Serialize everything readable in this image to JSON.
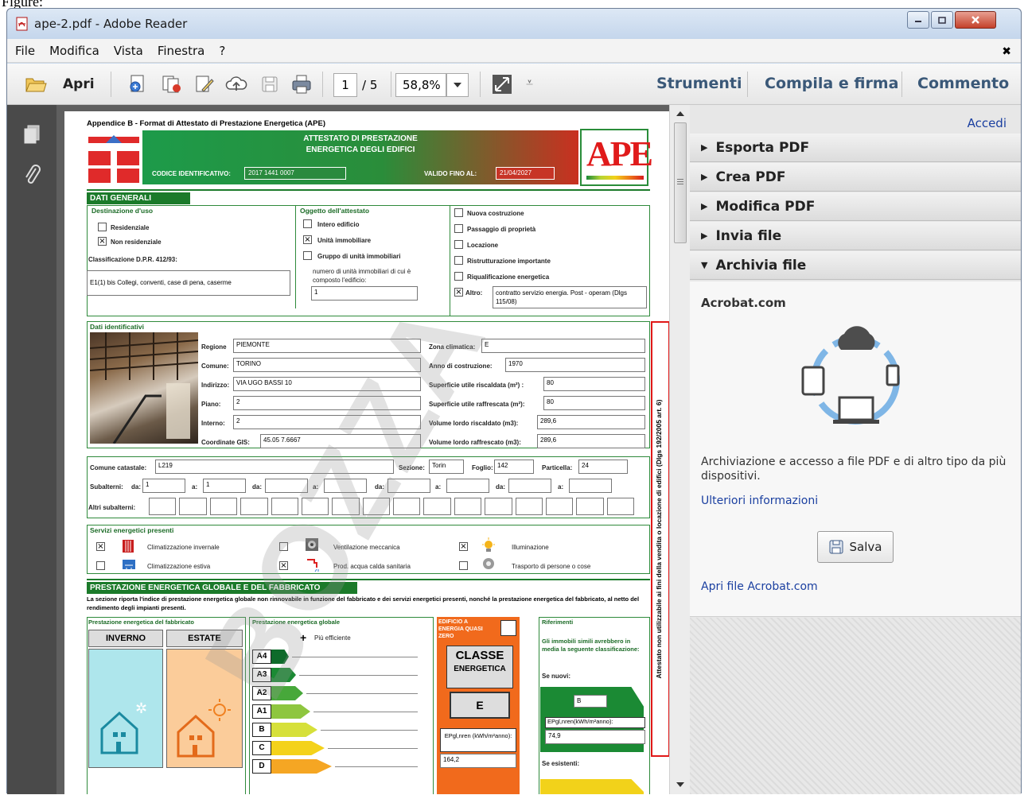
{
  "above_text": "Figure:",
  "window": {
    "title": "ape-2.pdf - Adobe Reader"
  },
  "menu": [
    "File",
    "Modifica",
    "Vista",
    "Finestra",
    "?"
  ],
  "toolbar": {
    "open_label": "Apri",
    "page_current": "1",
    "page_total": "/ 5",
    "zoom": "58,8%",
    "tools_label": "Strumenti",
    "fill_sign_label": "Compila e firma",
    "comment_label": "Commento"
  },
  "right_panel": {
    "signin": "Accedi",
    "sections": [
      {
        "label": "Esporta PDF",
        "expanded": false
      },
      {
        "label": "Crea PDF",
        "expanded": false
      },
      {
        "label": "Modifica PDF",
        "expanded": false
      },
      {
        "label": "Invia file",
        "expanded": false
      },
      {
        "label": "Archivia file",
        "expanded": true
      }
    ],
    "acrobat_title": "Acrobat.com",
    "description": "Archiviazione e accesso a file PDF e di altro tipo da più dispositivi.",
    "more_info": "Ulteriori informazioni",
    "save_label": "Salva",
    "open_acrobat": "Apri file Acrobat.com"
  },
  "doc": {
    "appendix_title": "Appendice B - Format di Attestato di Prestazione Energetica (APE)",
    "header_title_1": "ATTESTATO DI PRESTAZIONE",
    "header_title_2": "ENERGETICA DEGLI EDIFICI",
    "code_label": "CODICE IDENTIFICATIVO:",
    "code_value": "2017 1441 0007",
    "valid_label": "VALIDO FINO AL:",
    "valid_value": "21/04/2027",
    "ape_logo": "APE",
    "dati_generali": "DATI GENERALI",
    "destinazione_title": "Destinazione d'uso",
    "residenziale": "Residenziale",
    "non_residenziale": "Non residenziale",
    "classificazione_label": "Classificazione D.P.R. 412/93:",
    "classificazione_value": "E1(1) bis Collegi, conventi, case di pena, caserme",
    "oggetto_title": "Oggetto dell'attestato",
    "intero_edificio": "Intero edificio",
    "unita_immobiliare": "Unità immobiliare",
    "gruppo_unita": "Gruppo di unità immobiliari",
    "numero_unita_label": "numero di unità immobiliari di cui è composto l'edificio:",
    "numero_unita_value": "1",
    "nuova_costruzione": "Nuova costruzione",
    "passaggio": "Passaggio di proprietà",
    "locazione": "Locazione",
    "ristrutturazione": "Ristrutturazione importante",
    "riqualificazione": "Riqualificazione energetica",
    "altro_label": "Altro:",
    "altro_value": "contratto servizio energia. Post - operam (Dlgs 115/08)",
    "dati_identificativi": "Dati identificativi",
    "regione_label": "Regione",
    "regione_value": "PIEMONTE",
    "comune_label": "Comune:",
    "comune_value": "TORINO",
    "indirizzo_label": "Indirizzo:",
    "indirizzo_value": "VIA UGO BASSI 10",
    "piano_label": "Piano:",
    "piano_value": "2",
    "interno_label": "Interno:",
    "interno_value": "2",
    "gis_label": "Coordinate GIS:",
    "gis_value": "45.05 7.6667",
    "zona_label": "Zona climatica:",
    "zona_value": "E",
    "anno_label": "Anno di costruzione:",
    "anno_value": "1970",
    "sup_risc_label": "Superficie utile riscaldata (m²) :",
    "sup_risc_value": "80",
    "sup_raff_label": "Superficie utile raffrescata (m²):",
    "sup_raff_value": "80",
    "vol_risc_label": "Volume lordo riscaldato (m3):",
    "vol_risc_value": "289,6",
    "vol_raff_label": "Volume lordo raffrescato (m3):",
    "vol_raff_value": "289,6",
    "comune_catastale_label": "Comune catastale:",
    "comune_catastale_value": "L219",
    "sezione_label": "Sezione:",
    "sezione_value": "Torin",
    "foglio_label": "Foglio:",
    "foglio_value": "142",
    "particella_label": "Particella:",
    "particella_value": "24",
    "subalterni_label": "Subalterni:",
    "da_label": "da:",
    "a_label": "a:",
    "sub_da_value": "1",
    "sub_a_value": "1",
    "altri_subalterni_label": "Altri subalterni:",
    "servizi_title": "Servizi energetici presenti",
    "clim_invernale": "Climatizzazione invernale",
    "clim_estiva": "Climatizzazione estiva",
    "ventilazione": "Ventilazione meccanica",
    "acqua_calda": "Prod. acqua calda sanitaria",
    "illuminazione": "Illuminazione",
    "trasporto": "Trasporto di persone o cose",
    "prestazione_title": "PRESTAZIONE ENERGETICA GLOBALE E DEL FABBRICATO",
    "prestazione_desc": "La sezione riporta l'indice di prestazione energetica globale non rinnovabile in funzione del fabbricato e dei servizi energetici presenti, nonché la prestazione energetica del fabbricato, al netto del rendimento degli impianti presenti.",
    "prest_fabbricato": "Prestazione energetica del fabbricato",
    "inverno": "INVERNO",
    "estate": "ESTATE",
    "prest_globale": "Prestazione energetica globale",
    "piu_efficiente": "Più efficiente",
    "classes": [
      "A4",
      "A3",
      "A2",
      "A1",
      "B",
      "C",
      "D"
    ],
    "nzeb": "EDIFICIO A ENERGIA QUASI ZERO",
    "classe_label_1": "CLASSE",
    "classe_label_2": "ENERGETICA",
    "classe_value": "E",
    "epgl_label": "EPgl,nren (kWh/m²anno):",
    "epgl_value": "164,2",
    "riferimenti_title": "Riferimenti",
    "riferimenti_desc": "Gli immobili simili avrebbero in media la seguente classificazione:",
    "se_nuovi": "Se nuovi:",
    "nuovi_class": "B",
    "nuovi_ep_label": "EPgl,nren(kWh/m²anno):",
    "nuovi_ep_value": "74,9",
    "se_esistenti": "Se esistenti:",
    "side_note": "Attestato non utilizzabile ai fini della vendita o locazione di edifici (Dlgs 192/2005 art. 6)",
    "watermark": "BOZZA"
  },
  "colors": {
    "doc_green": "#1b7a2a",
    "link_blue": "#1a3fa0",
    "side_note_border": "#e01818"
  }
}
